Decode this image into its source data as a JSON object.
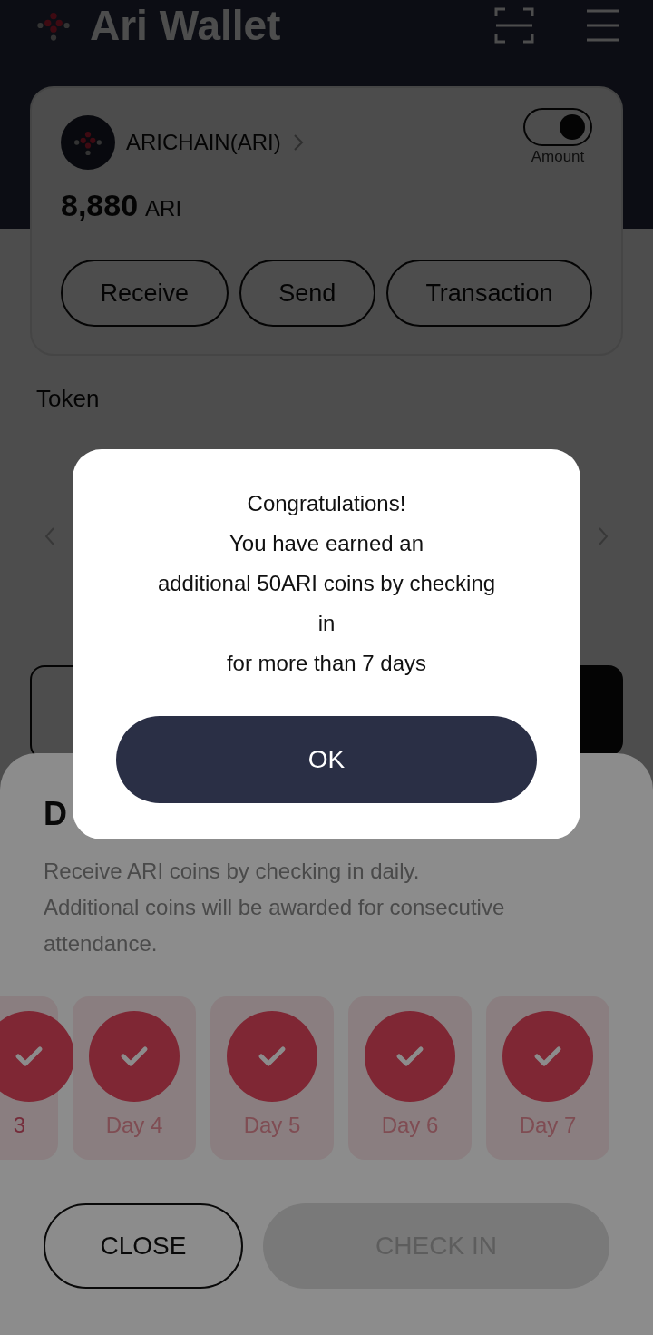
{
  "header": {
    "title": "Ari Wallet"
  },
  "wallet_card": {
    "chain": "ARICHAIN(ARI)",
    "amount_toggle": {
      "label": "Amount",
      "on": true
    },
    "balance": "8,880",
    "unit": "ARI",
    "actions": [
      "Receive",
      "Send",
      "Transaction"
    ]
  },
  "token_section": {
    "title": "Token"
  },
  "check_in_sheet": {
    "title": "D",
    "description": "Receive ARI coins by checking in daily.\nAdditional coins will be awarded for consecutive attendance.",
    "days": [
      {
        "label": "3",
        "checked": true,
        "cut": true
      },
      {
        "label": "Day 4",
        "checked": true
      },
      {
        "label": "Day 5",
        "checked": true
      },
      {
        "label": "Day 6",
        "checked": true
      },
      {
        "label": "Day 7",
        "checked": true
      }
    ],
    "buttons": [
      {
        "label": "CLOSE",
        "kind": "outline",
        "disabled": false
      },
      {
        "label": "CHECK IN",
        "kind": "filled",
        "disabled": true
      }
    ]
  },
  "dialog": {
    "lines": [
      "Congratulations!",
      "You have earned an",
      "additional 50ARI coins by checking",
      "in",
      "for more than 7 days"
    ],
    "button": "OK"
  }
}
